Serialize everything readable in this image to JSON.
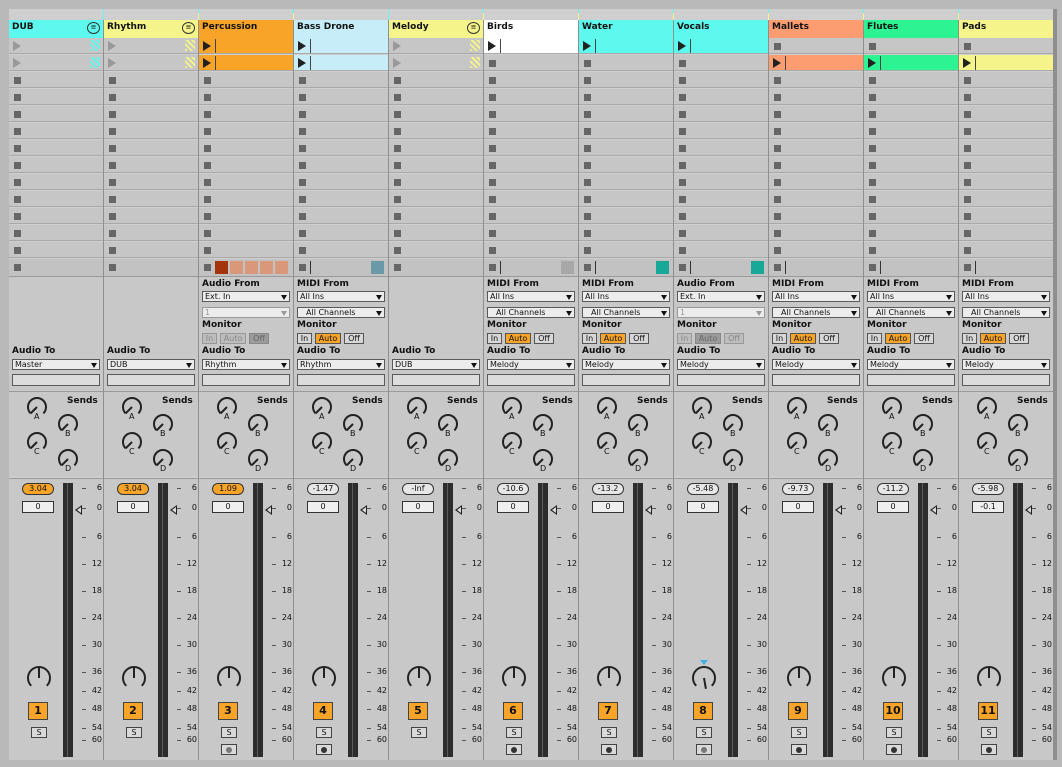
{
  "colors": {
    "orange": "#f7a428",
    "yellow": "#f4f48a",
    "cyan": "#5ef9ee",
    "lightblue": "#c7eef8",
    "salmon": "#fb9d71",
    "green": "#2ef392",
    "white": "#ffffff"
  },
  "labels": {
    "sends": "Sends",
    "audio_from": "Audio From",
    "midi_from": "MIDI From",
    "monitor": "Monitor",
    "audio_to": "Audio To",
    "mon_in": "In",
    "mon_auto": "Auto",
    "mon_off": "Off",
    "solo": "S",
    "send_a": "A",
    "send_b": "B",
    "send_c": "C",
    "send_d": "D"
  },
  "meter_ticks": [
    "6",
    "0",
    "6",
    "12",
    "18",
    "24",
    "30",
    "36",
    "42",
    "48",
    "54",
    "60"
  ],
  "tracks": [
    {
      "name": "DUB",
      "color": "cyan",
      "kind": "group",
      "input_label": "",
      "input": "",
      "channel": "",
      "monitor": "",
      "output": "Master",
      "volume": "3.04",
      "pan": "0",
      "number": "1",
      "clips": [
        "hatch",
        "hatch"
      ],
      "stat": "",
      "arm": ""
    },
    {
      "name": "Rhythm",
      "color": "yellow",
      "kind": "group",
      "input_label": "",
      "input": "",
      "channel": "",
      "monitor": "",
      "output": "DUB",
      "volume": "3.04",
      "pan": "0",
      "number": "2",
      "clips": [
        "hatch",
        "hatch"
      ],
      "stat": "",
      "arm": ""
    },
    {
      "name": "Percussion",
      "color": "orange",
      "kind": "audio",
      "input_label": "Audio From",
      "input": "Ext. In",
      "channel": "1",
      "monitor": "off-dis",
      "output": "Rhythm",
      "volume": "1.09",
      "pan": "0",
      "number": "3",
      "clips": [
        "orange",
        "orange"
      ],
      "stat": "boxes",
      "arm": "audio"
    },
    {
      "name": "Bass Drone",
      "color": "lightblue",
      "kind": "midi",
      "input_label": "MIDI From",
      "input": "All Ins",
      "channel": "All Channels",
      "monitor": "auto",
      "output": "Rhythm",
      "volume": "-1.47",
      "pan": "0",
      "number": "4",
      "clips": [
        "lightblue",
        "lightblue"
      ],
      "stat": "#6a9aa7",
      "arm": "midi"
    },
    {
      "name": "Melody",
      "color": "yellow",
      "kind": "group",
      "input_label": "",
      "input": "",
      "channel": "",
      "monitor": "",
      "output": "DUB",
      "volume": "-Inf",
      "pan": "0",
      "number": "5",
      "clips": [
        "hatch",
        "hatch"
      ],
      "stat": "",
      "arm": ""
    },
    {
      "name": "Birds",
      "color": "white",
      "kind": "midi",
      "input_label": "MIDI From",
      "input": "All Ins",
      "channel": "All Channels",
      "monitor": "auto",
      "output": "Melody",
      "volume": "-10.6",
      "pan": "0",
      "number": "6",
      "clips": [
        "white",
        "stop"
      ],
      "stat": "#a8a8a8",
      "arm": "midi"
    },
    {
      "name": "Water",
      "color": "cyan",
      "kind": "midi",
      "input_label": "MIDI From",
      "input": "All Ins",
      "channel": "All Channels",
      "monitor": "auto",
      "output": "Melody",
      "volume": "-13.2",
      "pan": "0",
      "number": "7",
      "clips": [
        "cyan",
        "stop"
      ],
      "stat": "#17a897",
      "arm": "midi"
    },
    {
      "name": "Vocals",
      "color": "cyan",
      "kind": "audio",
      "input_label": "Audio From",
      "input": "Ext. In",
      "channel": "1",
      "monitor": "auto-dis",
      "output": "Melody",
      "volume": "-5.48",
      "pan": "0",
      "number": "8",
      "clips": [
        "cyan",
        "stop"
      ],
      "stat": "#17a897",
      "arm": "audio"
    },
    {
      "name": "Mallets",
      "color": "salmon",
      "kind": "midi",
      "input_label": "MIDI From",
      "input": "All Ins",
      "channel": "All Channels",
      "monitor": "auto",
      "output": "Melody",
      "volume": "-9.73",
      "pan": "0",
      "number": "9",
      "clips": [
        "stop",
        "salmon"
      ],
      "stat": "line",
      "arm": "midi"
    },
    {
      "name": "Flutes",
      "color": "green",
      "kind": "midi",
      "input_label": "MIDI From",
      "input": "All Ins",
      "channel": "All Channels",
      "monitor": "auto",
      "output": "Melody",
      "volume": "-11.2",
      "pan": "0",
      "number": "10",
      "clips": [
        "stop",
        "green"
      ],
      "stat": "line",
      "arm": "midi"
    },
    {
      "name": "Pads",
      "color": "yellow",
      "kind": "midi",
      "input_label": "MIDI From",
      "input": "All Ins",
      "channel": "All Channels",
      "monitor": "auto",
      "output": "Melody",
      "volume": "-5.98",
      "pan": "-0.1",
      "number": "11",
      "clips": [
        "stop",
        "yellow"
      ],
      "stat": "line",
      "arm": "midi"
    }
  ]
}
